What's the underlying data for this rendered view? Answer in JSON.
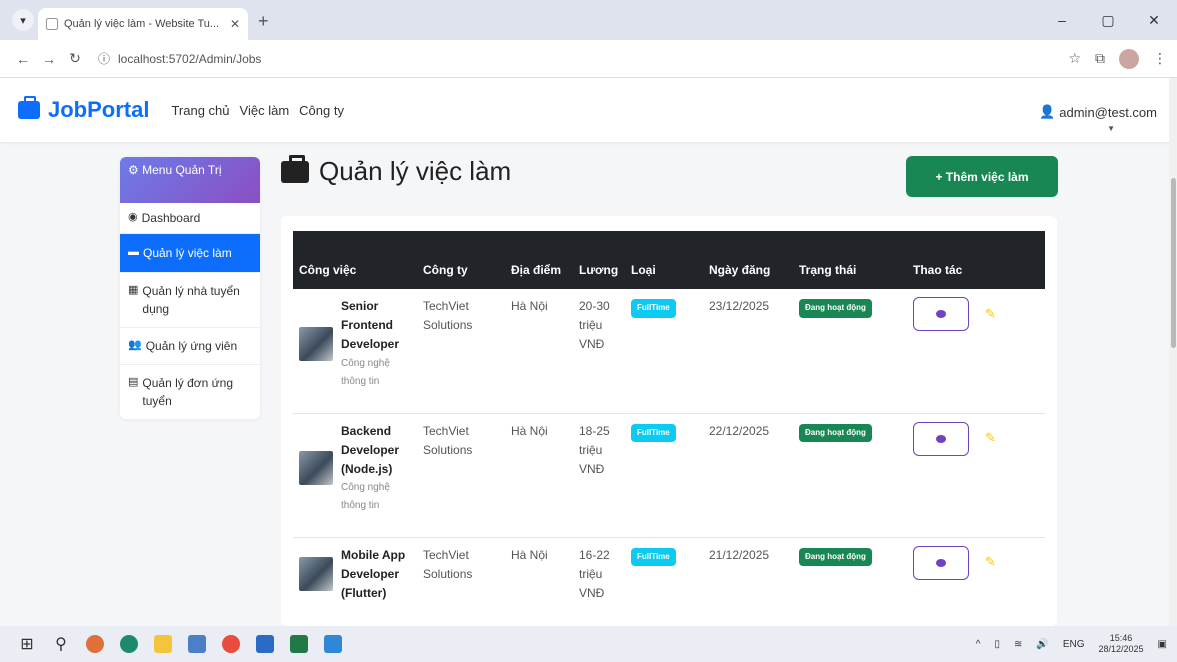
{
  "browser": {
    "tab_title": "Quản lý việc làm - Website Tu...",
    "tab_close": "✕",
    "new_tab": "+",
    "url": "localhost:5702/Admin/Jobs",
    "min": "–",
    "max": "▢",
    "close": "✕"
  },
  "app": {
    "brand": "JobPortal",
    "nav": [
      "Trang chủ",
      "Việc làm",
      "Công ty"
    ],
    "user": "admin@test.com"
  },
  "sidebar": {
    "header": "Menu Quản Trị",
    "items": [
      {
        "label": "Dashboard",
        "icon": "tachometer-icon"
      },
      {
        "label": "Quản lý việc làm",
        "icon": "briefcase-icon"
      },
      {
        "label": "Quản lý nhà tuyển dụng",
        "icon": "building-icon"
      },
      {
        "label": "Quản lý ứng viên",
        "icon": "users-icon"
      },
      {
        "label": "Quản lý đơn ứng tuyển",
        "icon": "file-icon"
      }
    ]
  },
  "main": {
    "title": "Quản lý việc làm",
    "add_button": "+ Thêm việc làm",
    "columns": [
      "Công việc",
      "Công ty",
      "Địa điểm",
      "Lương",
      "Loại",
      "Ngày đăng",
      "Trạng thái",
      "Thao tác"
    ],
    "rows": [
      {
        "title": "Senior Frontend Developer",
        "category": "Công nghệ thông tin",
        "company": "TechViet Solutions",
        "location": "Hà Nội",
        "salary": "20-30 triệu VNĐ",
        "type": "FullTime",
        "date": "23/12/2025",
        "status": "Đang hoạt động"
      },
      {
        "title": "Backend Developer (Node.js)",
        "category": "Công nghệ thông tin",
        "company": "TechViet Solutions",
        "location": "Hà Nội",
        "salary": "18-25 triệu VNĐ",
        "type": "FullTime",
        "date": "22/12/2025",
        "status": "Đang hoạt động"
      },
      {
        "title": "Mobile App Developer (Flutter)",
        "category": "",
        "company": "TechViet Solutions",
        "location": "Hà Nội",
        "salary": "16-22 triệu VNĐ",
        "type": "FullTime",
        "date": "21/12/2025",
        "status": "Đang hoạt động"
      }
    ]
  },
  "taskbar": {
    "lang": "ENG",
    "time": "15:46",
    "date": "28/12/2025"
  }
}
